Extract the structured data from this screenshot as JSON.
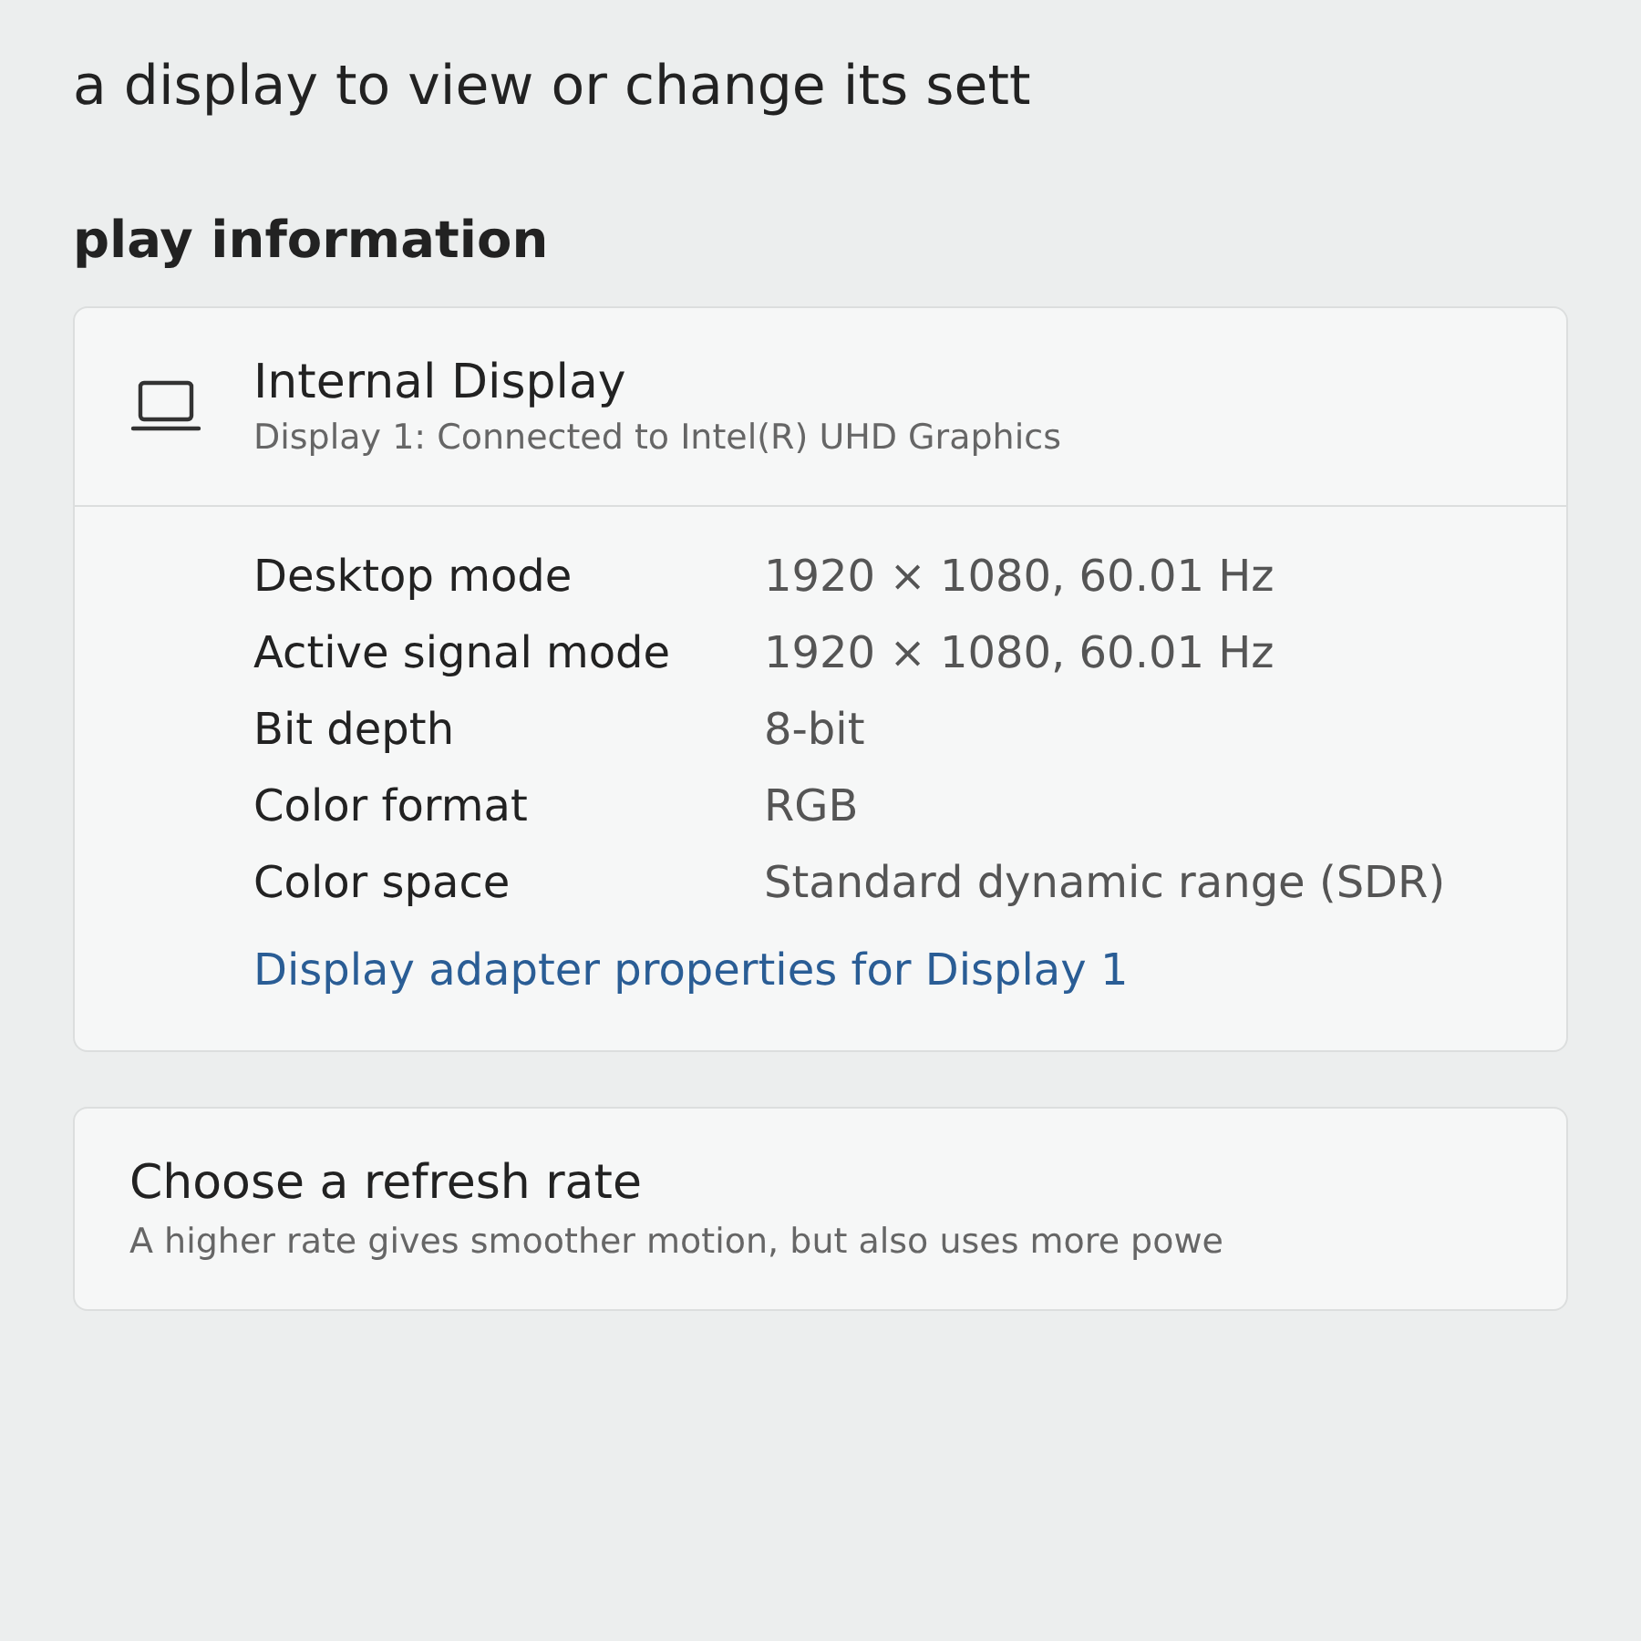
{
  "intro": "a display to view or change its sett",
  "section_title": "play information",
  "display_card": {
    "name": "Internal Display",
    "subtitle": "Display 1: Connected to Intel(R) UHD Graphics",
    "properties": [
      {
        "label": "Desktop mode",
        "value": "1920 × 1080, 60.01 Hz"
      },
      {
        "label": "Active signal mode",
        "value": "1920 × 1080, 60.01 Hz"
      },
      {
        "label": "Bit depth",
        "value": "8-bit"
      },
      {
        "label": "Color format",
        "value": "RGB"
      },
      {
        "label": "Color space",
        "value": "Standard dynamic range (SDR)"
      }
    ],
    "link": "Display adapter properties for Display 1"
  },
  "refresh_card": {
    "title": "Choose a refresh rate",
    "description": "A higher rate gives smoother motion, but also uses more powe"
  }
}
